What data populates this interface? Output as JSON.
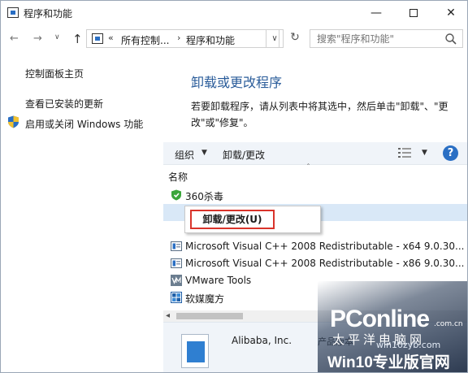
{
  "window": {
    "title": "程序和功能",
    "minimize_glyph": "—",
    "close_glyph": "✕"
  },
  "navbar": {
    "back_glyph": "←",
    "forward_glyph": "→",
    "history_glyph": "∨",
    "up_glyph": "↑",
    "address_chevron": "«",
    "address_items": [
      "所有控制...",
      "程序和功能"
    ],
    "address_separator": "›",
    "dropdown_glyph": "∨",
    "refresh_glyph": "↻",
    "search_placeholder": "搜索\"程序和功能\""
  },
  "sidebar": {
    "items": [
      {
        "label": "控制面板主页"
      },
      {
        "label": "查看已安装的更新"
      },
      {
        "label": "启用或关闭 Windows 功能",
        "icon": "shield-icon"
      }
    ]
  },
  "main": {
    "heading": "卸载或更改程序",
    "description": "若要卸载程序，请从列表中将其选中，然后单击\"卸载\"、\"更改\"或\"修复\"。"
  },
  "toolbar": {
    "organize_label": "组织",
    "organize_arrow": "▼",
    "uninstall_label": "卸载/更改",
    "view_arrow": "▼",
    "help_label": "?"
  },
  "list": {
    "column_name": "名称",
    "sort_glyph": "ˆ",
    "rows": [
      {
        "label": "360杀毒",
        "icon": "360-shield-icon"
      },
      {
        "label": "",
        "icon": "",
        "selected": true
      },
      {
        "label": "Microsoft Visual C++ 2008 Redistributable - x64 9.0.30...",
        "icon": "msi-installer-icon"
      },
      {
        "label": "Microsoft Visual C++ 2008 Redistributable - x86 9.0.30...",
        "icon": "msi-installer-icon"
      },
      {
        "label": "VMware Tools",
        "icon": "vmware-icon"
      },
      {
        "label": "软媒魔方",
        "icon": "cube-icon"
      }
    ]
  },
  "context_menu": {
    "item_label": "卸载/更改(U)"
  },
  "scrollbar": {
    "left_glyph": "◂"
  },
  "details": {
    "publisher": "Alibaba, Inc.",
    "property_label": "产品版本"
  },
  "watermark": {
    "logo": "PConline",
    "domain_suffix": ".com.cn",
    "tagline": "太平洋电脑网",
    "site": "win10zyb.com",
    "brand": "Win10专业版官网"
  },
  "colors": {
    "heading": "#2a5c9a",
    "selection": "#d9e8f7",
    "highlight_border": "#d9342b",
    "help": "#2a6fc4"
  }
}
